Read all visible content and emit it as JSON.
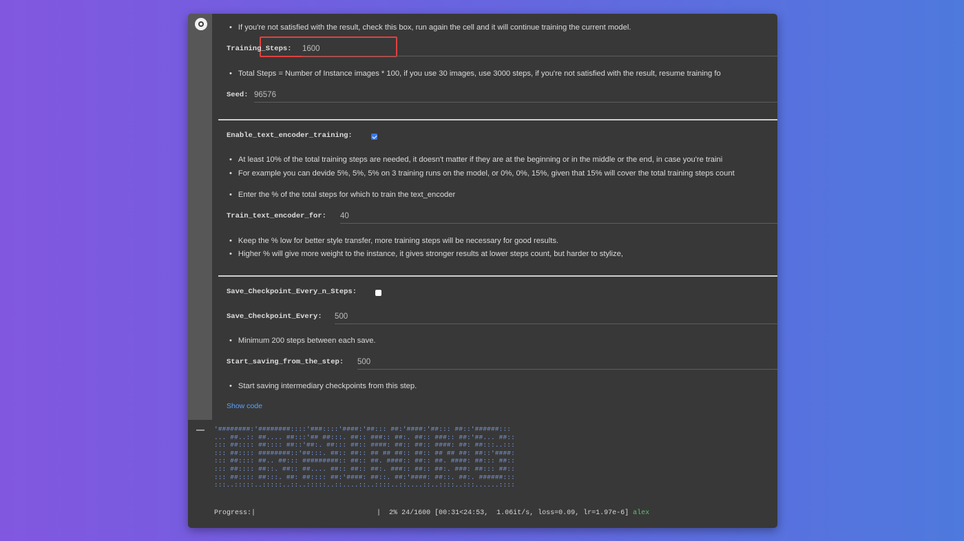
{
  "colors": {
    "highlight": "#e2413f",
    "checkbox_checked": "#3b78e7",
    "link": "#5aa1ff",
    "ascii_art": "#7ea1ea",
    "username": "#5fbf6e"
  },
  "cell": {
    "run_button_icon": "run-cell-icon",
    "notes": {
      "resume": "If you're not satisfied with the result, check this box, run again the cell and it will continue training the current model.",
      "total_steps": "Total Steps = Number of Instance images * 100, if you use 30 images, use 3000 steps, if you're not satisfied with the result, resume training fo",
      "text_encoder_1": "At least 10% of the total training steps are needed, it doesn't matter if they are at the beginning or in the middle or the end, in case you're traini",
      "text_encoder_2": "For example you can devide 5%, 5%, 5% on 3 training runs on the model, or 0%, 0%, 15%, given that 15% will cover the total training steps count",
      "text_encoder_3": "Enter the % of the total steps for which to train the text_encoder",
      "style_1": "Keep the % low for better style transfer, more training steps will be necessary for good results.",
      "style_2": "Higher % will give more weight to the instance, it gives stronger results at lower steps count, but harder to stylize,",
      "checkpoint_min": "Minimum 200 steps between each save.",
      "start_saving": "Start saving intermediary checkpoints from this step."
    },
    "fields": {
      "training_steps": {
        "label": "Training_Steps:",
        "value": "1600"
      },
      "seed": {
        "label": "Seed:",
        "value": "96576"
      },
      "enable_text_encoder": {
        "label": "Enable_text_encoder_training:",
        "checked": true
      },
      "train_text_encoder_for": {
        "label": "Train_text_encoder_for:",
        "value": "40"
      },
      "save_checkpoint_every_n": {
        "label": "Save_Checkpoint_Every_n_Steps:",
        "checked": false
      },
      "save_checkpoint_every": {
        "label": "Save_Checkpoint_Every:",
        "value": "500"
      },
      "start_saving_from": {
        "label": "Start_saving_from_the_step:",
        "value": "500"
      }
    },
    "show_code": "Show code"
  },
  "output": {
    "ascii_lines": [
      "'########:'########::::'###::::'####:'##::: ##:'####:'##::: ##::'######:::",
      "... ##..:: ##.... ##:::'## ##:::. ##:: ###:: ##:. ##:: ###:: ##:'##... ##::",
      "::: ##:::: ##:::: ##::'##:. ##::: ##:: ####: ##:: ##:: ####: ##: ##:::..:::",
      "::: ##:::: ########::'##:::. ##:: ##:: ## ## ##:: ##:: ## ## ##: ##::'####:",
      "::: ##:::: ##.. ##::: #########:: ##:: ##. ####:: ##:: ##. ####: ##::: ##::",
      "::: ##:::: ##::. ##:: ##.... ##:: ##:: ##:. ###:: ##:: ##:. ###: ##::: ##::",
      "::: ##:::: ##:::. ##: ##:::: ##:'####: ##::. ##:'####: ##::. ##:. ######:::",
      ":::..:::::..:::::..::..:::::..::....::..::::..::....::..::::..:::......::::"
    ],
    "progress": {
      "label": "Progress:|",
      "end": "|",
      "percent": "2%",
      "fraction": 0.02,
      "status": "24/1600 [00:31<24:53,  1.06it/s, loss=0.09, lr=1.97e-6]",
      "user": "alex"
    }
  }
}
